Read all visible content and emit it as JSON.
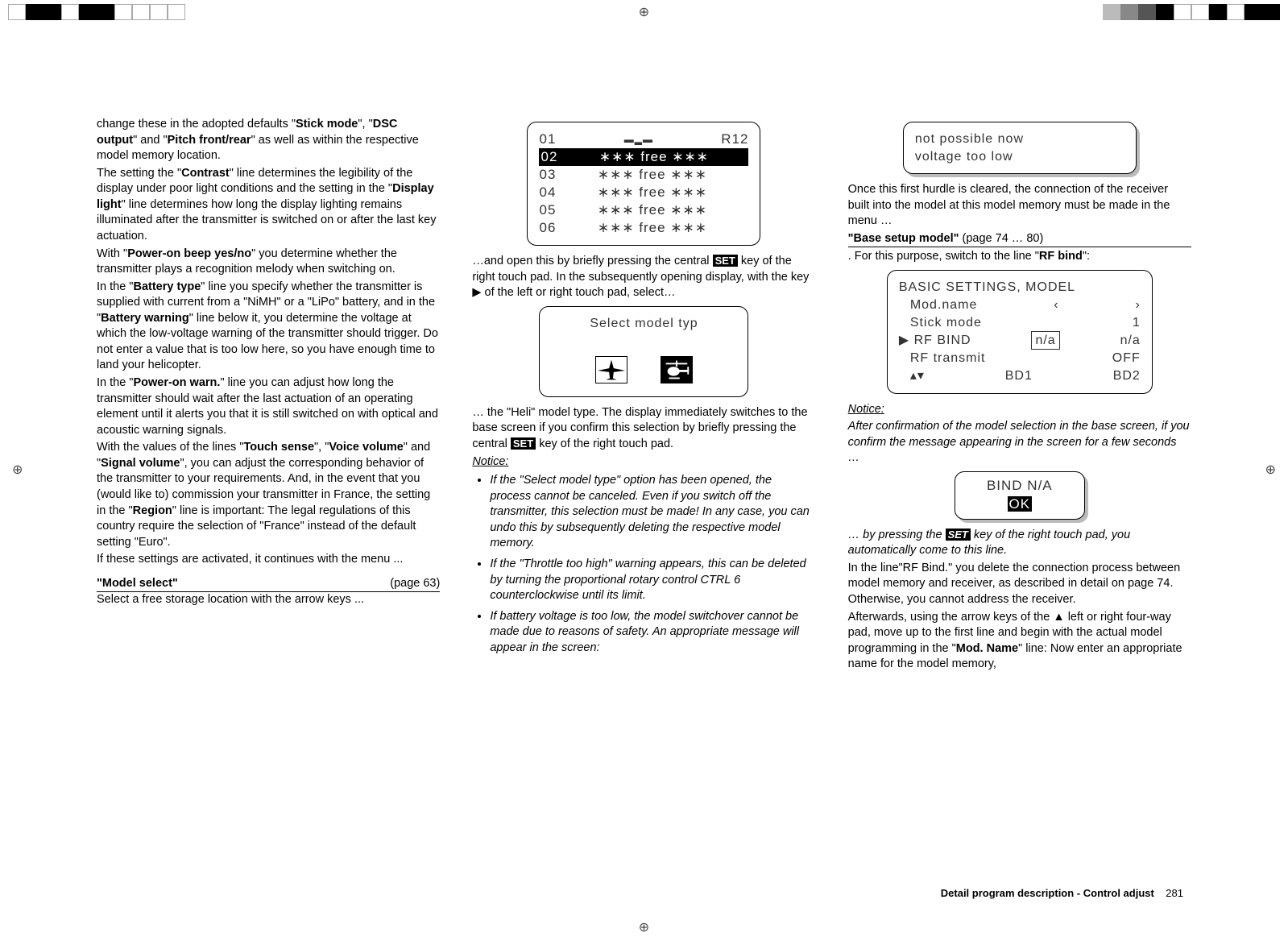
{
  "col1": {
    "p1a": "change these in the adopted defaults \"",
    "p1b": "Stick mode",
    "p1c": "\", \"",
    "p1d": "DSC output",
    "p1e": "\" and \"",
    "p1f": "Pitch front/rear",
    "p1g": "\" as well as within the respective model memory location.",
    "p2a": "The setting the \"",
    "p2b": "Contrast",
    "p2c": "\" line determines the legibility of the display under poor light conditions and the setting in the \"",
    "p2d": "Display light",
    "p2e": "\" line determines how long the display lighting remains illuminated after the transmitter is switched on or after the last key actuation.",
    "p3a": "With \"",
    "p3b": "Power-on beep yes/no",
    "p3c": "\" you determine whether the transmitter plays a recognition melody when switching on.",
    "p4a": "In the \"",
    "p4b": "Battery type",
    "p4c": "\" line you specify whether the transmitter is supplied with current from a \"NiMH\" or a \"LiPo\" battery, and in the \"",
    "p4d": "Battery warning",
    "p4e": "\" line below it, you determine the voltage at which the low-voltage warning of the transmitter should trigger. Do not enter a value that is too low here, so you have enough time to land your helicopter.",
    "p5a": "In the \"",
    "p5b": "Power-on warn.",
    "p5c": "\" line you can adjust how long the transmitter should wait after the last actuation of an operating element until it alerts you that it is still switched on with optical and acoustic warning signals.",
    "p6a": "With the values of the lines \"",
    "p6b": "Touch sense",
    "p6c": "\", \"",
    "p6d": "Voice volume",
    "p6e": "\" and \"",
    "p6f": "Signal volume",
    "p6g": "\", you can adjust the corresponding behavior of the transmitter to your requirements. And, in the event that you (would like to) commission your transmitter in France, the setting in the \"",
    "p6h": "Region",
    "p6i": "\" line is important: The legal regulations of this country require the selection of \"France\" instead of the default setting \"Euro\".",
    "p7": "If these settings are activated, it continues with the menu ...",
    "sec_title": "\"Model select\"",
    "sec_page": "(page 63)",
    "p8": "Select a free storage location with the arrow keys ..."
  },
  "col2": {
    "lcd1": {
      "r1l": "01",
      "r1r": "R12",
      "rows": [
        "02",
        "03",
        "04",
        "05",
        "06"
      ],
      "free": "∗∗∗ free ∗∗∗"
    },
    "p1a": "…and open this by briefly pressing the central ",
    "p1b": "SET",
    "p1c": " key of the right touch pad. In the subsequently opening display, with the key  ▶  of the left or right touch pad, select…",
    "lcd2_title": "Select  model typ",
    "p2a": "… the \"Heli\" model type. The display immediately switches to the base screen if you confirm this selection by briefly pressing the central ",
    "p2b": "SET",
    "p2c": " key of the right touch pad.",
    "notice_h": "Notice:",
    "n1": "If the \"Select model type\" option has been opened, the process cannot be canceled. Even if you switch off the transmitter, this selection must be made! In any case, you can undo this by subsequently deleting the respective model memory.",
    "n2": "If the \"Throttle too high\" warning appears, this can be deleted by turning the proportional rotary control CTRL 6 counterclockwise until its limit.",
    "n3": "If battery voltage is too low, the model switchover cannot be made due to reasons of safety. An appropriate message will appear in the screen:"
  },
  "col3": {
    "lcd_warn1": "not  possible  now",
    "lcd_warn2": "voltage  too  low",
    "p1": "Once this first hurdle is cleared, the connection of the receiver built into the model at this model memory must be made in the menu …",
    "sec2a": "\"Base setup model\"",
    "sec2b": " (page 74 … 80)",
    "p2a": ". For this purpose, switch to the line \"",
    "p2b": "RF bind",
    "p2c": "\":",
    "lcd3": {
      "title": "BASIC  SETTINGS,  MODEL",
      "r1l": "Mod.name",
      "r1m": "‹",
      "r1r": "›",
      "r2l": "Stick mode",
      "r2r": "1",
      "r3l": "RF BIND",
      "r3m": "n/a",
      "r3r": "n/a",
      "r4l": "RF transmit",
      "r4r": "OFF",
      "r5m": "BD1",
      "r5r": "BD2"
    },
    "notice_h": "Notice:",
    "n_text": "After confirmation of the model selection in the base screen, if you confirm the message appearing in the screen for a few seconds …",
    "lcd4a": "BIND N/A",
    "lcd4b": "OK",
    "p3a": "… by pressing the ",
    "p3b": "SET",
    "p3c": " key of the right touch pad, you automatically come to this line.",
    "p4": "In the line\"RF Bind.\" you delete the connection process between model memory and receiver, as described in detail on page 74. Otherwise, you cannot address the receiver.",
    "p5a": "Afterwards, using the arrow keys of the  ▲  left or right four-way pad, move up to the first line and begin with the actual model programming in the \"",
    "p5b": "Mod. Name",
    "p5c": "\" line: Now enter an appropriate name for the model memory,"
  },
  "footer": {
    "label": "Detail program description - Control adjust",
    "page": "281"
  }
}
